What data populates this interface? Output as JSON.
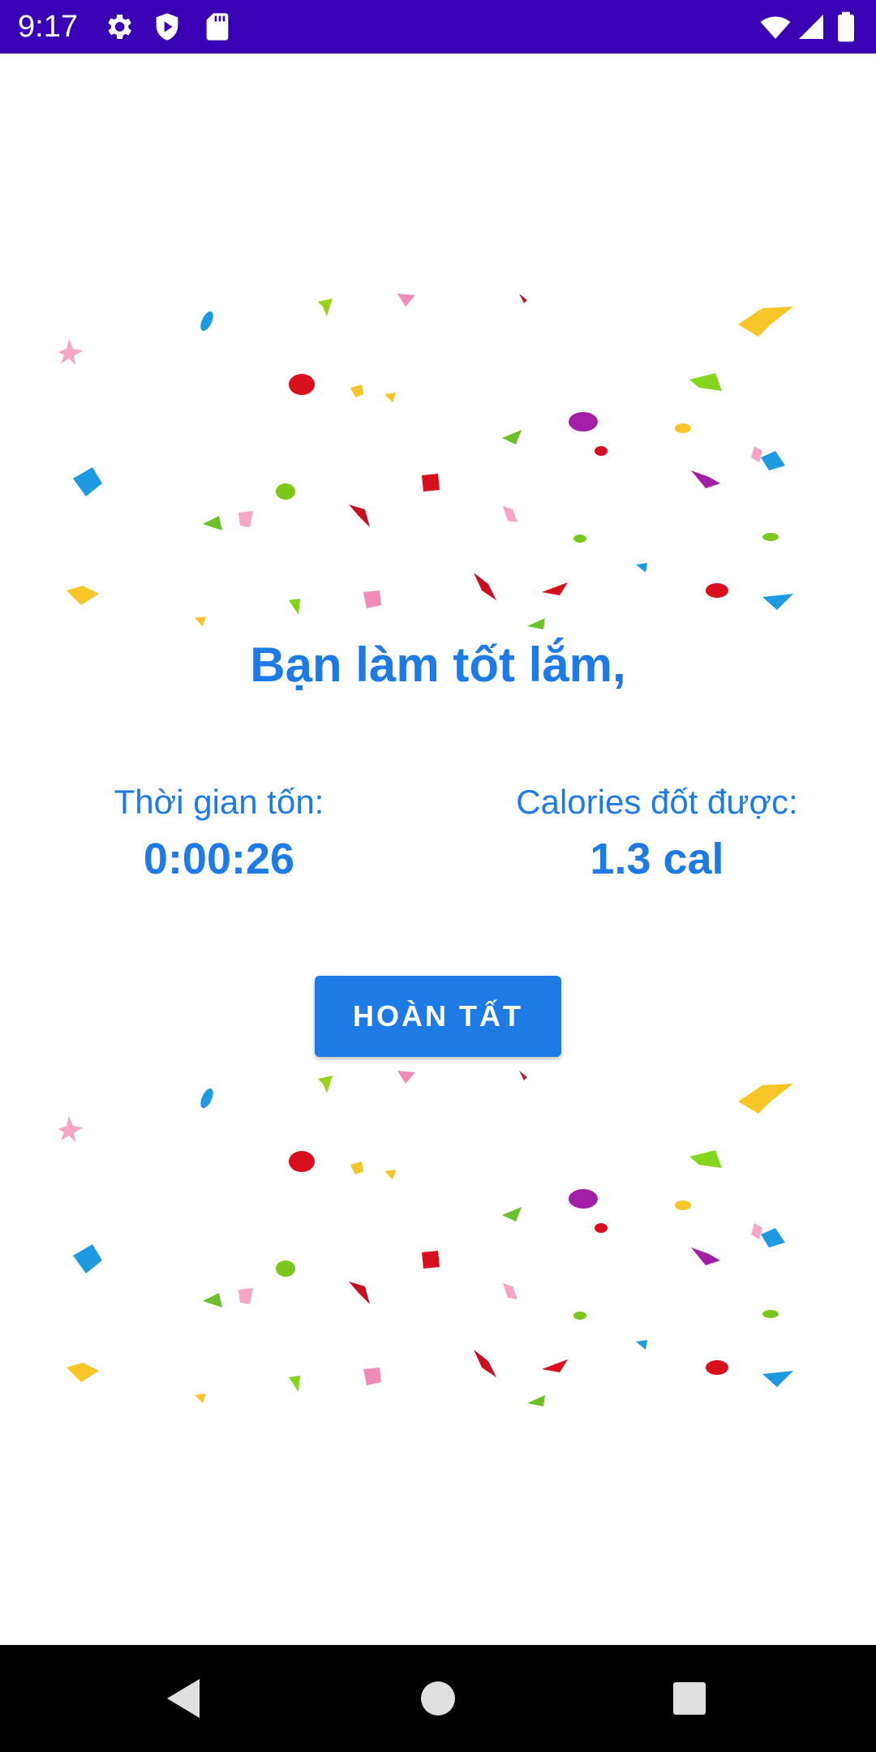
{
  "status_bar": {
    "time": "9:17",
    "background": "#3a00b3",
    "left_icons": [
      "gear-icon",
      "shield-play-icon",
      "sd-card-icon"
    ],
    "right_icons": [
      "wifi-icon",
      "signal-icon",
      "battery-icon"
    ]
  },
  "main": {
    "headline": "Bạn làm tốt lắm,",
    "time_label": "Thời gian tốn:",
    "time_value": "0:00:26",
    "calories_label": "Calories đốt được:",
    "calories_value": "1.3 cal",
    "done_button": "HOÀN TẤT",
    "accent_color": "#1e7be6"
  },
  "navigation": {
    "items": [
      "back-icon",
      "home-icon",
      "recents-icon"
    ]
  }
}
